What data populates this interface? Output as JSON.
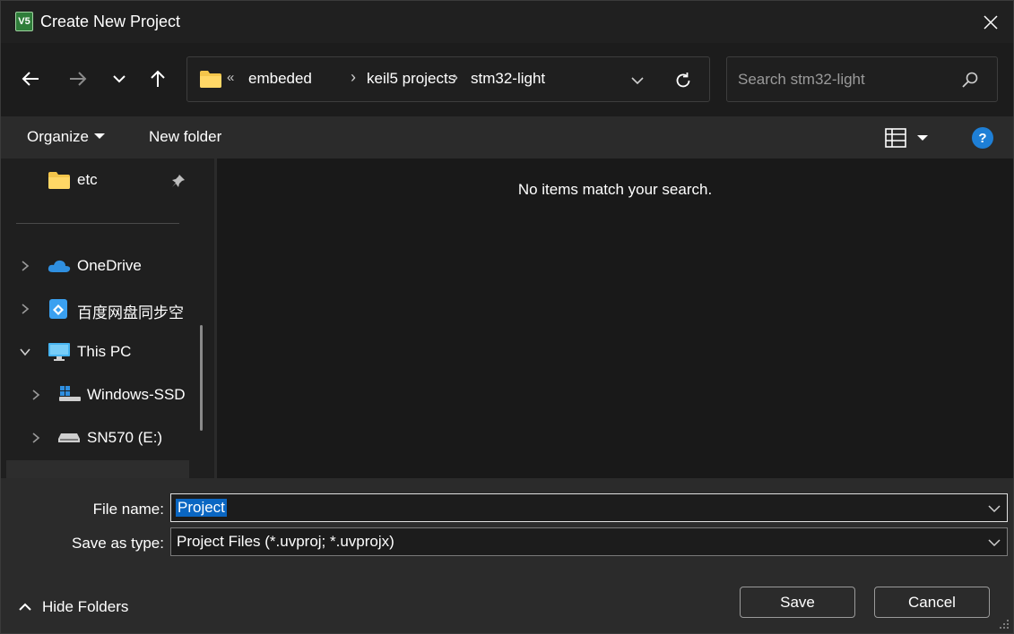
{
  "window": {
    "title": "Create New Project",
    "app_icon_text": "V5"
  },
  "address": {
    "overflow": "«",
    "crumbs": [
      "embeded",
      "keil5 projects",
      "stm32-light"
    ]
  },
  "search": {
    "placeholder": "Search stm32-light"
  },
  "toolbar": {
    "organize": "Organize",
    "new_folder": "New folder",
    "help": "?"
  },
  "nav": {
    "items": [
      {
        "label": "etc"
      },
      {
        "label": "OneDrive"
      },
      {
        "label": "百度网盘同步空"
      },
      {
        "label": "This PC"
      },
      {
        "label": "Windows-SSD"
      },
      {
        "label": "SN570 (E:)"
      }
    ]
  },
  "content": {
    "empty_message": "No items match your search."
  },
  "form": {
    "file_name_label": "File name:",
    "file_name_value": "Project",
    "save_type_label": "Save as type:",
    "save_type_value": "Project Files (*.uvproj; *.uvprojx)"
  },
  "footer": {
    "hide_folders": "Hide Folders",
    "save": "Save",
    "cancel": "Cancel"
  },
  "colors": {
    "accent": "#1e7fd6",
    "selection": "#0a66c2",
    "folder": "#f4c54b"
  }
}
